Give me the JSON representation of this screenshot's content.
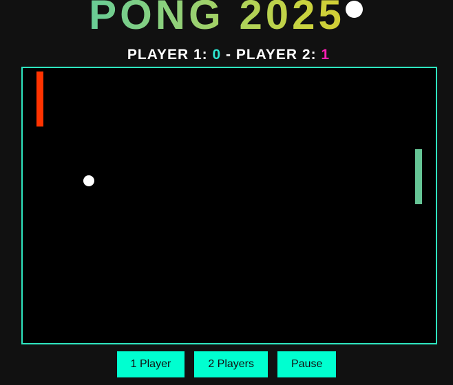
{
  "header": {
    "title": "PONG 2025"
  },
  "scoreboard": {
    "player1_label": "PLAYER 1: ",
    "player1_score": "0",
    "separator": " - ",
    "player2_label": "PLAYER 2: ",
    "player2_score": "1"
  },
  "game": {
    "left_paddle_color": "#ff3300",
    "right_paddle_color": "#66c495",
    "ball_color": "#ffffff",
    "field_border_color": "#2ee6c0"
  },
  "controls": {
    "one_player_label": "1 Player",
    "two_players_label": "2 Players",
    "pause_label": "Pause"
  },
  "colors": {
    "accent": "#00ffd0",
    "player1_score_color": "#2ee6d0",
    "player2_score_color": "#ff1fb4",
    "background": "#111111"
  }
}
